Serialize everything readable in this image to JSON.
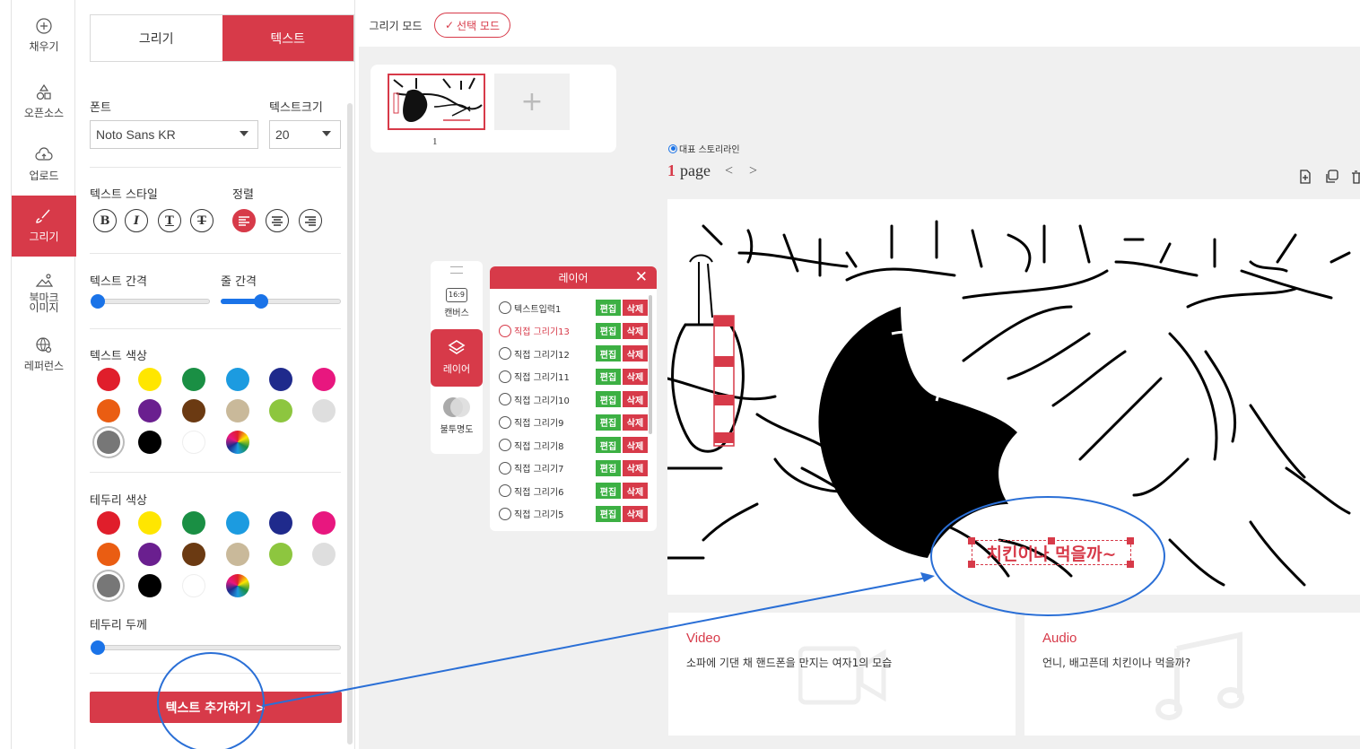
{
  "nav": {
    "items": [
      {
        "label": "채우기",
        "icon": "plus-circle-icon"
      },
      {
        "label": "오픈소스",
        "icon": "shapes-icon"
      },
      {
        "label": "업로드",
        "icon": "upload-cloud-icon"
      },
      {
        "label": "그리기",
        "icon": "brush-icon"
      },
      {
        "label": "북마크\n이미지",
        "icon": "bookmark-image-icon"
      },
      {
        "label": "레퍼런스",
        "icon": "globe-search-icon"
      }
    ]
  },
  "panel": {
    "tabs": [
      "그리기",
      "텍스트"
    ],
    "font_label": "폰트",
    "font_value": "Noto Sans KR",
    "size_label": "텍스트크기",
    "size_value": "20",
    "style_label": "텍스트 스타일",
    "align_label": "정렬",
    "style_buttons": [
      "B",
      "I",
      "T",
      "T"
    ],
    "letter_spacing_label": "텍스트 간격",
    "line_spacing_label": "줄 간격",
    "letter_spacing_value": 0,
    "line_spacing_value": 0.33,
    "text_color_label": "텍스트 색상",
    "border_color_label": "테두리 색상",
    "border_width_label": "테두리 두께",
    "border_width_value": 0,
    "swatches": [
      "#e01e2b",
      "#ffe600",
      "#1a8f44",
      "#1c9be0",
      "#1f2a8c",
      "#e8177f",
      "#ea5d12",
      "#6a1f8f",
      "#6b3a12",
      "#c9b99a",
      "#8dc63f",
      "#dedede",
      "#777777",
      "#000000",
      "#ffffff",
      "rainbow"
    ],
    "add_text_button": "텍스트 추가하기 >"
  },
  "topbar": {
    "draw_mode": "그리기 모드",
    "select_mode": "선택 모드"
  },
  "thumbs": {
    "page_number": "1",
    "add": "+"
  },
  "storyline": {
    "radio_label": "대표 스토리라인",
    "page_num": "1",
    "page_word": "page"
  },
  "toolcol": {
    "canvas_label": "캔버스",
    "canvas_ratio": "16:9",
    "layer_label": "레이어",
    "opacity_label": "불투명도"
  },
  "layers": {
    "title": "레이어",
    "edit": "편집",
    "delete": "삭제",
    "rows": [
      "텍스트입력1",
      "직접 그리기13",
      "직접 그리기12",
      "직접 그리기11",
      "직접 그리기10",
      "직접 그리기9",
      "직접 그리기8",
      "직접 그리기7",
      "직접 그리기6",
      "직접 그리기5"
    ]
  },
  "canvas": {
    "overlay_text": "치킨이나 먹을까~"
  },
  "cards": {
    "video_title": "Video",
    "video_desc": "소파에 기댄 채 핸드폰을 만지는 여자1의 모습",
    "audio_title": "Audio",
    "audio_desc": "언니, 배고픈데 치킨이나 먹을까?"
  },
  "colors": {
    "accent": "#d73a49",
    "annotation_blue": "#2a6fd6",
    "edit_green": "#3cb043"
  }
}
